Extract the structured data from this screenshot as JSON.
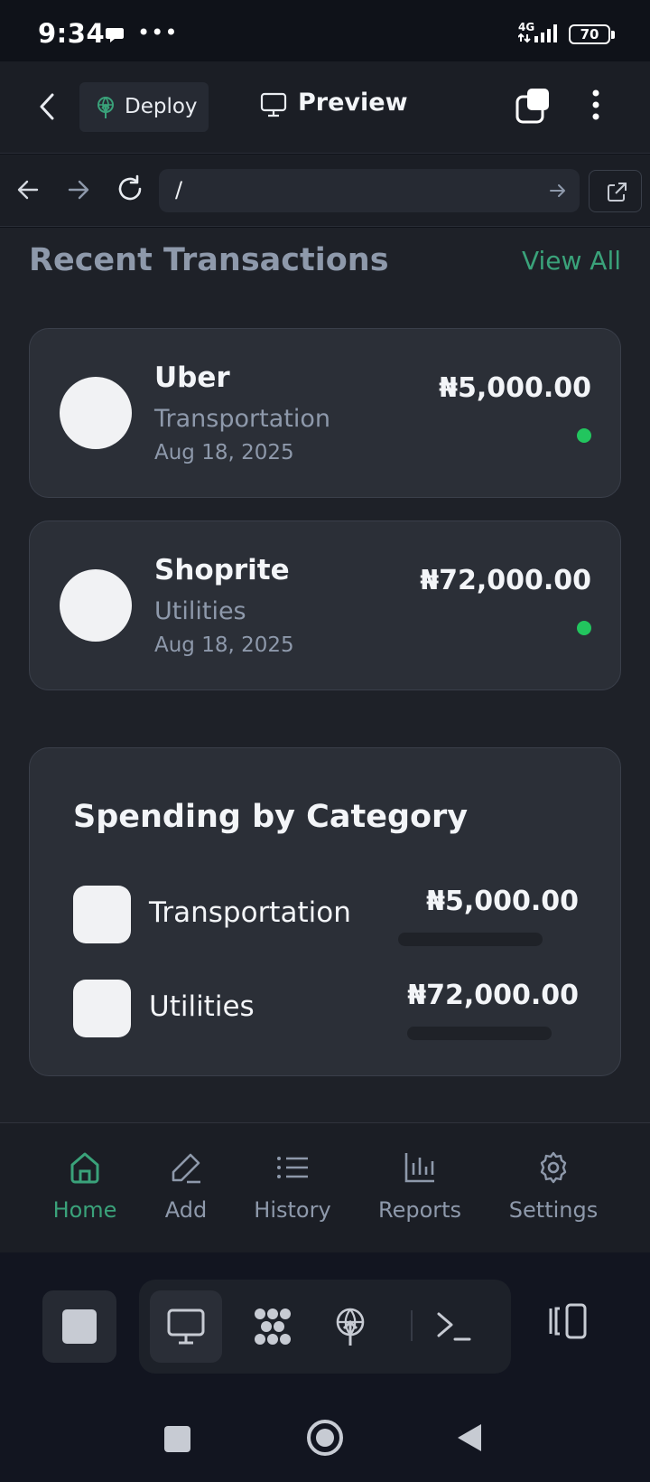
{
  "status_bar": {
    "time": "9:34",
    "network": "4G",
    "battery": "70"
  },
  "header": {
    "deploy_label": "Deploy",
    "preview_label": "Preview"
  },
  "browser": {
    "url": "/"
  },
  "transactions": {
    "title": "Recent Transactions",
    "view_all": "View All",
    "items": [
      {
        "name": "Uber",
        "category": "Transportation",
        "date": "Aug 18, 2025",
        "amount": "₦5,000.00"
      },
      {
        "name": "Shoprite",
        "category": "Utilities",
        "date": "Aug 18, 2025",
        "amount": "₦72,000.00"
      }
    ]
  },
  "spending": {
    "title": "Spending by Category",
    "items": [
      {
        "name": "Transportation",
        "amount": "₦5,000.00"
      },
      {
        "name": "Utilities",
        "amount": "₦72,000.00"
      }
    ]
  },
  "bottom_nav": {
    "items": [
      {
        "label": "Home",
        "icon": "home-icon",
        "active": true
      },
      {
        "label": "Add",
        "icon": "pencil-icon",
        "active": false
      },
      {
        "label": "History",
        "icon": "list-icon",
        "active": false
      },
      {
        "label": "Reports",
        "icon": "bar-chart-icon",
        "active": false
      },
      {
        "label": "Settings",
        "icon": "gear-icon",
        "active": false
      }
    ]
  },
  "colors": {
    "accent": "#3aa27a",
    "status_dot": "#22c55e",
    "background": "#1e2128",
    "card": "#2b2f37"
  }
}
